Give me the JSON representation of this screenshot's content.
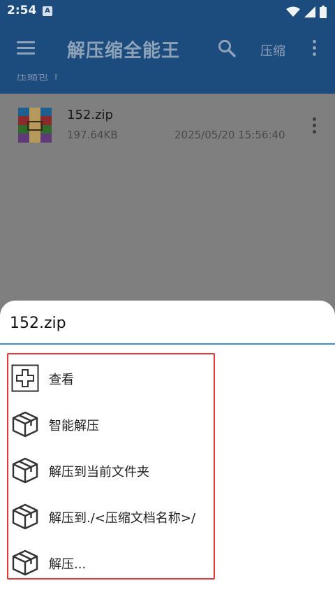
{
  "status_bar": {
    "time": "2:54",
    "notification_badge": "A"
  },
  "app_bar": {
    "title": "解压缩全能王",
    "compress_label": "压缩",
    "icons": [
      "menu-icon",
      "search-icon",
      "overflow-icon"
    ]
  },
  "breadcrumb": {
    "text": "压缩包 ↑"
  },
  "file_list": {
    "items": [
      {
        "name": "152.zip",
        "size": "197.64KB",
        "date": "2025/05/20 15:56:40",
        "icon": "archive-icon"
      }
    ]
  },
  "sheet": {
    "title": "152.zip",
    "menu": [
      {
        "label": "查看",
        "icon": "view-plus-icon"
      },
      {
        "label": "智能解压",
        "icon": "package-icon"
      },
      {
        "label": "解压到当前文件夹",
        "icon": "package-icon"
      },
      {
        "label": "解压到./<压缩文档名称>/",
        "icon": "package-icon"
      },
      {
        "label": "解压...",
        "icon": "package-icon"
      }
    ]
  },
  "colors": {
    "app_bar": "#1c4b7e",
    "highlight_border": "#e53935",
    "divider": "#3b8fd6"
  }
}
